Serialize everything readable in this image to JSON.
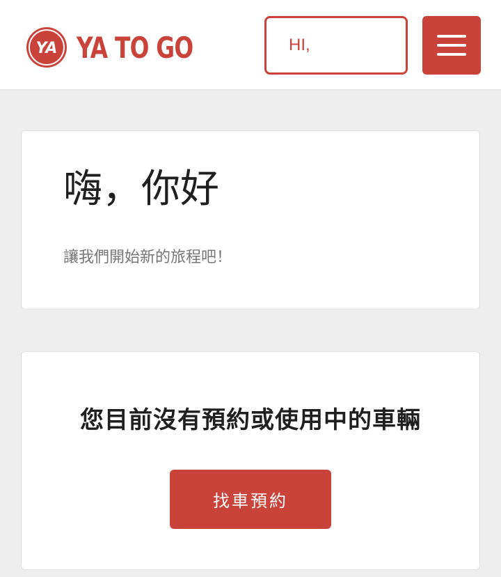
{
  "header": {
    "logo_text": "YA TO GO",
    "logo_badge_text": "YA",
    "greeting_box": "HI,",
    "menu_icon": "hamburger-menu-icon"
  },
  "greeting_card": {
    "title": "嗨，你好",
    "subtitle": "讓我們開始新的旅程吧！"
  },
  "status_card": {
    "message": "您目前沒有預約或使用中的車輛",
    "button_label": "找車預約"
  },
  "colors": {
    "brand_red": "#c9433a",
    "background": "#eeeeee",
    "card": "#ffffff",
    "text_dark": "#1f1f1f",
    "text_muted": "#777777"
  }
}
